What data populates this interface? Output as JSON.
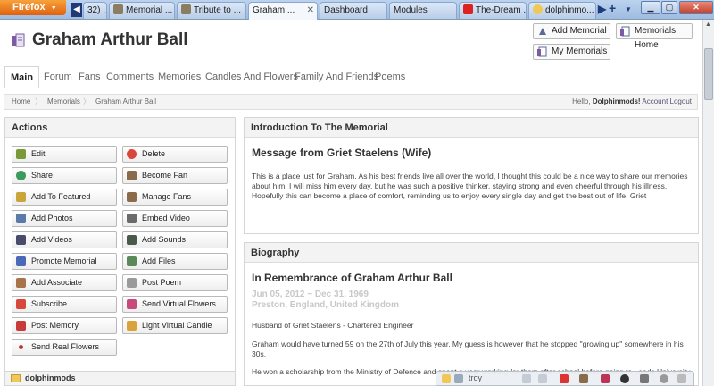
{
  "browser": {
    "menu_label": "Firefox",
    "tabs": [
      {
        "label": "32) ...",
        "icon": "page"
      },
      {
        "label": "Memorial ...",
        "icon": "tree"
      },
      {
        "label": "Tribute to ...",
        "icon": "tree"
      },
      {
        "label": "Graham ...",
        "icon": "page",
        "active": true
      },
      {
        "label": "Dashboard",
        "icon": "page"
      },
      {
        "label": "Modules",
        "icon": "page"
      },
      {
        "label": "The-Dream ...",
        "icon": "youtube"
      },
      {
        "label": "dolphinmo...",
        "icon": "dolphin"
      }
    ],
    "new_tab_label": "+"
  },
  "header": {
    "title": "Graham Arthur Ball",
    "buttons": {
      "add_memorial": "Add Memorial",
      "memorials_home": "Memorials Home",
      "my_memorials": "My Memorials"
    }
  },
  "nav": {
    "items": [
      "Main",
      "Forum",
      "Fans",
      "Comments",
      "Memories",
      "Candles And Flowers",
      "Family And Friends",
      "Poems"
    ],
    "active": "Main"
  },
  "breadcrumb": {
    "items": [
      "Home",
      "Memorials",
      "Graham Arthur Ball"
    ],
    "greeting_prefix": "Hello,",
    "username": "Dolphinmods!",
    "account_link": "Account",
    "logout_link": "Logout"
  },
  "actions": {
    "heading": "Actions",
    "buttons": [
      {
        "label": "Edit",
        "icon": "pencil-icon",
        "color": "#7a9a3a"
      },
      {
        "label": "Delete",
        "icon": "delete-icon",
        "color": "#d9463c"
      },
      {
        "label": "Share",
        "icon": "globe-icon",
        "color": "#3c9a5a"
      },
      {
        "label": "Become Fan",
        "icon": "user-icon",
        "color": "#8a6b4a"
      },
      {
        "label": "Add To Featured",
        "icon": "star-icon",
        "color": "#c9a63a"
      },
      {
        "label": "Manage Fans",
        "icon": "users-icon",
        "color": "#8a6b4a"
      },
      {
        "label": "Add Photos",
        "icon": "photo-icon",
        "color": "#5a7aa8"
      },
      {
        "label": "Embed Video",
        "icon": "film-icon",
        "color": "#6a6a6a"
      },
      {
        "label": "Add Videos",
        "icon": "video-icon",
        "color": "#4a4a6a"
      },
      {
        "label": "Add Sounds",
        "icon": "sound-icon",
        "color": "#4a5a4a"
      },
      {
        "label": "Promote Memorial",
        "icon": "promote-icon",
        "color": "#4a6ab8"
      },
      {
        "label": "Add Files",
        "icon": "file-icon",
        "color": "#5a8a5a"
      },
      {
        "label": "Add Associate",
        "icon": "associate-icon",
        "color": "#a8724a"
      },
      {
        "label": "Post Poem",
        "icon": "poem-icon",
        "color": "#9a9a9a"
      },
      {
        "label": "Subscribe",
        "icon": "pin-icon",
        "color": "#d9463c"
      },
      {
        "label": "Send Virtual Flowers",
        "icon": "flower-icon",
        "color": "#c94a7a"
      },
      {
        "label": "Post Memory",
        "icon": "memory-icon",
        "color": "#c93a3a"
      },
      {
        "label": "Light Virtual Candle",
        "icon": "candle-icon",
        "color": "#d9a23a"
      },
      {
        "label": "Send Real Flowers",
        "icon": "dot-icon",
        "color": "#b83a3a"
      }
    ]
  },
  "intro": {
    "heading": "Introduction To The Memorial",
    "message_title": "Message from Griet Staelens (Wife)",
    "message_body": "This is a place just for Graham. As his best friends live all over the world, I thought this could be a nice way to share our memories about him. I will miss him every day, but he was such a positive thinker, staying strong and even cheerful through his illness. Hopefully this can become a place of comfort, reminding us to enjoy every single day and get the best out of life. Griet"
  },
  "bio": {
    "heading": "Biography",
    "title": "In Remembrance of Graham Arthur Ball",
    "dates": "Jun 05, 2012 ~ Dec 31, 1969",
    "place": "Preston, England, United Kingdom",
    "paragraphs": [
      "Husband of Griet Staelens - Chartered Engineer",
      "Graham would have turned 59 on the 27th of July this year. My guess is however that he stopped \"growing up\" somewhere in his 30s.",
      "He won a scholarship from the Ministry of Defence and spent a year working for them after school before going to Leeds University."
    ]
  },
  "footer": {
    "label": "dolphinmods"
  },
  "statusbar": {
    "text": "troy"
  }
}
